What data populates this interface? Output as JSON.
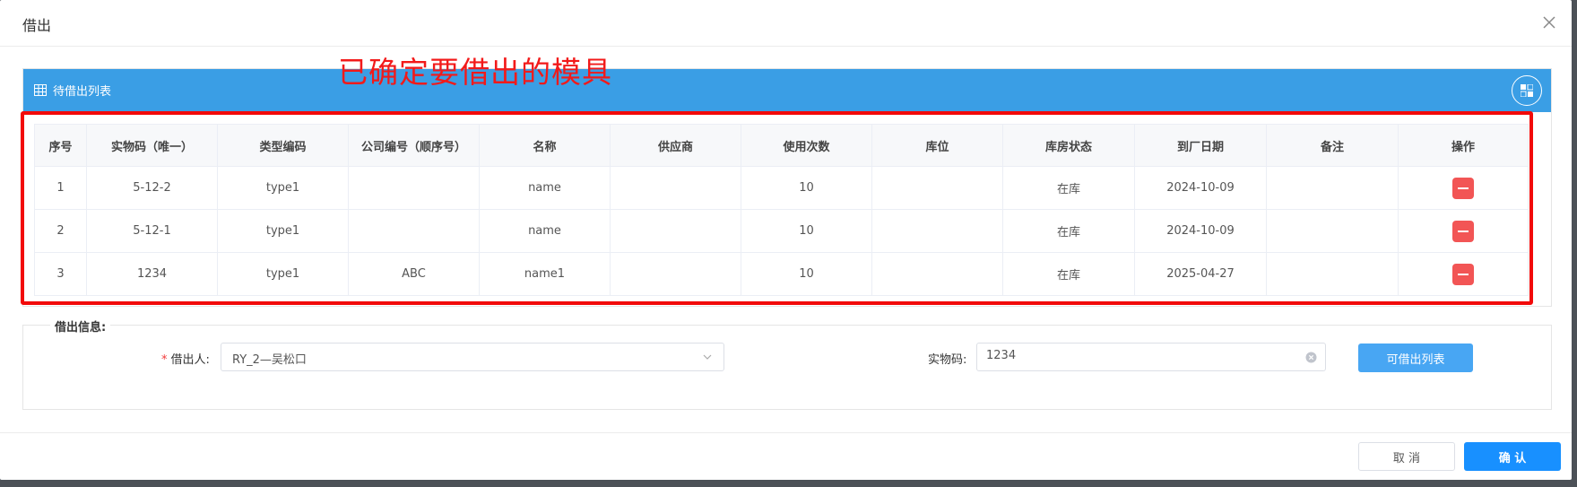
{
  "dialog": {
    "title": "借出"
  },
  "annotation": "已确定要借出的模具",
  "panel": {
    "title": "待借出列表"
  },
  "table": {
    "columns": [
      "序号",
      "实物码（唯一）",
      "类型编码",
      "公司编号（顺序号）",
      "名称",
      "供应商",
      "使用次数",
      "库位",
      "库房状态",
      "到厂日期",
      "备注",
      "操作"
    ],
    "rows": [
      [
        "1",
        "5-12-2",
        "type1",
        "",
        "name",
        "",
        "10",
        "",
        "在库",
        "2024-10-09",
        ""
      ],
      [
        "2",
        "5-12-1",
        "type1",
        "",
        "name",
        "",
        "10",
        "",
        "在库",
        "2024-10-09",
        ""
      ],
      [
        "3",
        "1234",
        "type1",
        "ABC",
        "name1",
        "",
        "10",
        "",
        "在库",
        "2025-04-27",
        ""
      ]
    ]
  },
  "form": {
    "legend": "借出信息:",
    "borrower_label": "借出人:",
    "borrower_value": "RY_2—吴松口",
    "code_label": "实物码:",
    "code_value": "1234",
    "list_button": "可借出列表"
  },
  "footer": {
    "cancel": "取 消",
    "confirm": "确 认"
  },
  "colors": {
    "header_blue": "#3a9ee5",
    "annotation_red": "#f21a1a",
    "delete_red": "#f25555",
    "primary": "#1890ff"
  }
}
